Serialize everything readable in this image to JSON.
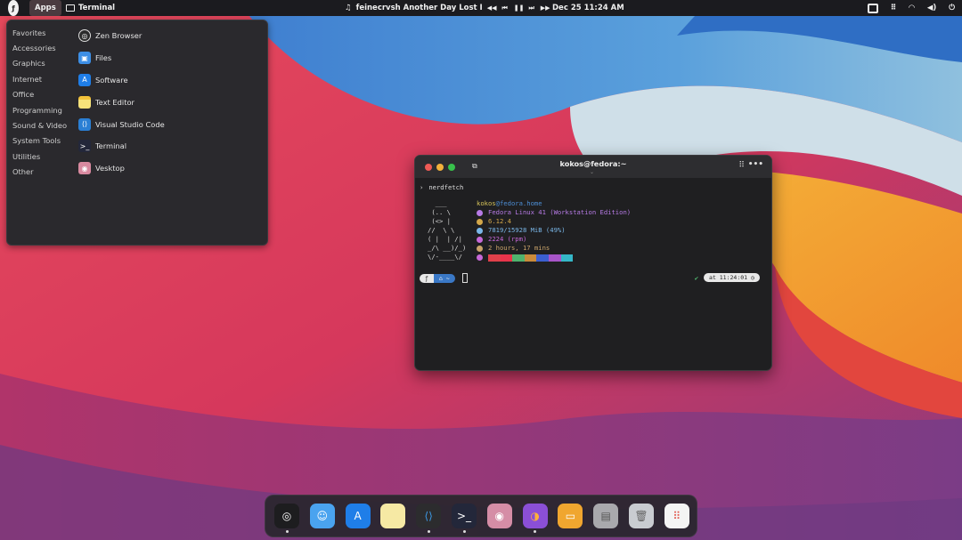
{
  "topbar": {
    "apps_label": "Apps",
    "active_app": "Terminal",
    "now_playing": "feinecrvsh Another Day Lost I",
    "clock": "Dec 25  11:24 AM"
  },
  "apps_menu": {
    "categories": [
      "Favorites",
      "Accessories",
      "Graphics",
      "Internet",
      "Office",
      "Programming",
      "Sound & Video",
      "System Tools",
      "Utilities",
      "Other"
    ],
    "apps": [
      {
        "name": "Zen Browser",
        "icon": "zen-browser-icon",
        "color": "#2b2b2b"
      },
      {
        "name": "Files",
        "icon": "files-icon",
        "color": "#3d8fe6"
      },
      {
        "name": "Software",
        "icon": "app-store-icon",
        "color": "#1f7ee8"
      },
      {
        "name": "Text Editor",
        "icon": "notes-icon",
        "color": "#f6e27a"
      },
      {
        "name": "Visual Studio Code",
        "icon": "vscode-icon",
        "color": "#2a7fd4"
      },
      {
        "name": "Terminal",
        "icon": "terminal-icon",
        "color": "#23273a"
      },
      {
        "name": "Vesktop",
        "icon": "vesktop-icon",
        "color": "#d98aa0"
      }
    ]
  },
  "terminal": {
    "title": "kokos@fedora:~",
    "command_prompt": "›",
    "command": "nerdfetch",
    "ascii": "  ___\n (.. \\\n (<> |\n//  \\ \\\n( |  | /|\n_/\\ __)/_)\n\\/-____\\/",
    "user": "kokos",
    "at_host": "@fedora.home",
    "info": [
      {
        "text": "Fedora Linux 41 (Workstation Edition)",
        "color": "#b77be6"
      },
      {
        "text": "6.12.4",
        "color": "#d3a74a"
      },
      {
        "text": "7819/15928 MiB (49%)",
        "color": "#7ab7e8"
      },
      {
        "text": "2224 (rpm)",
        "color": "#c768d8"
      },
      {
        "text": "2 hours, 17 mins",
        "color": "#c9a36a"
      }
    ],
    "swatch_colors": [
      "#e0404a",
      "#e8344b",
      "#4fb36e",
      "#c98a3b",
      "#3b5fd0",
      "#a855c9",
      "#35b7c8"
    ],
    "prompt_dir": "~",
    "prompt_check": "✔",
    "prompt_time": "at 11:24:01",
    "accent": "#3a78c6"
  },
  "dock": {
    "items": [
      {
        "name": "zen-browser-icon",
        "running": true
      },
      {
        "name": "finder-icon",
        "running": false
      },
      {
        "name": "app-store-icon",
        "running": false
      },
      {
        "name": "notes-icon",
        "running": false
      },
      {
        "name": "vscode-icon",
        "running": true
      },
      {
        "name": "terminal-icon",
        "running": true
      },
      {
        "name": "vesktop-icon",
        "running": false
      },
      {
        "name": "firefox-icon",
        "running": true
      },
      {
        "name": "drive-icon",
        "running": false
      },
      {
        "name": "disk-icon",
        "running": false
      },
      {
        "name": "trash-icon",
        "running": false
      },
      {
        "name": "app-grid-icon",
        "running": false
      }
    ]
  }
}
